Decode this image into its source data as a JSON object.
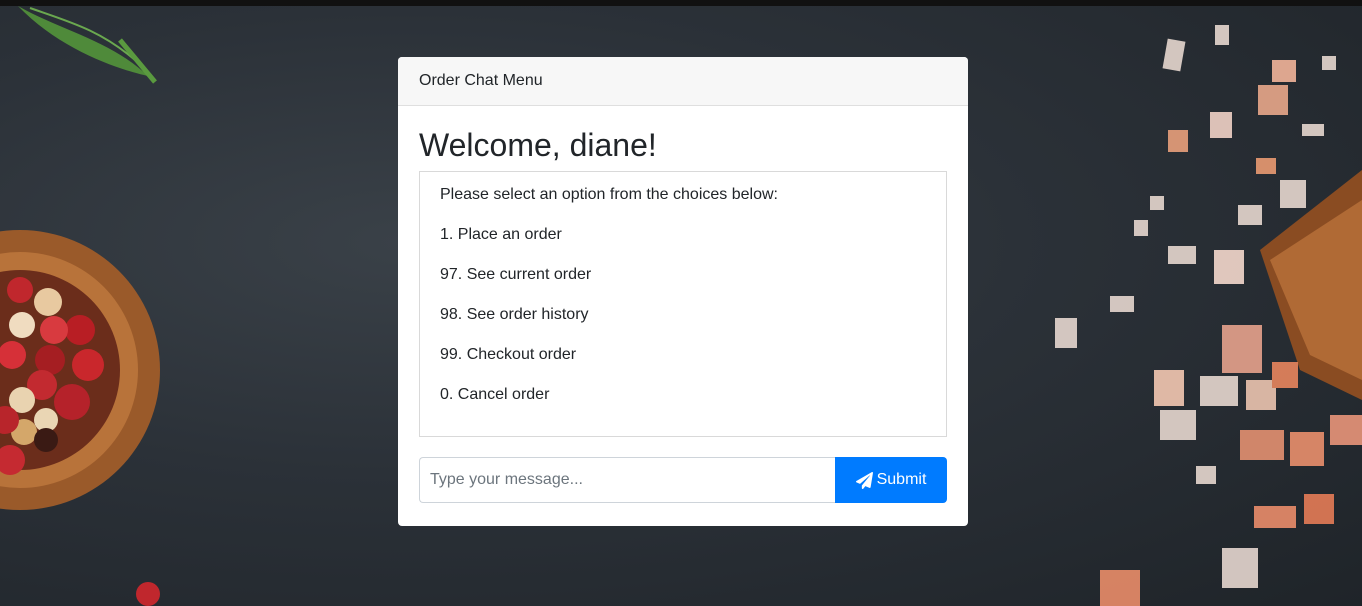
{
  "card": {
    "header": "Order Chat Menu",
    "welcome": "Welcome, diane!"
  },
  "chat": {
    "messages": [
      "Please select an option from the choices below:",
      "1. Place an order",
      "97. See current order",
      "98. See order history",
      "99. Checkout order",
      "0. Cancel order"
    ]
  },
  "input": {
    "placeholder": "Type your message...",
    "value": ""
  },
  "submit": {
    "label": "Submit",
    "icon": "paper-plane-icon"
  },
  "colors": {
    "accent": "#007bff",
    "background": "#2b3138"
  }
}
